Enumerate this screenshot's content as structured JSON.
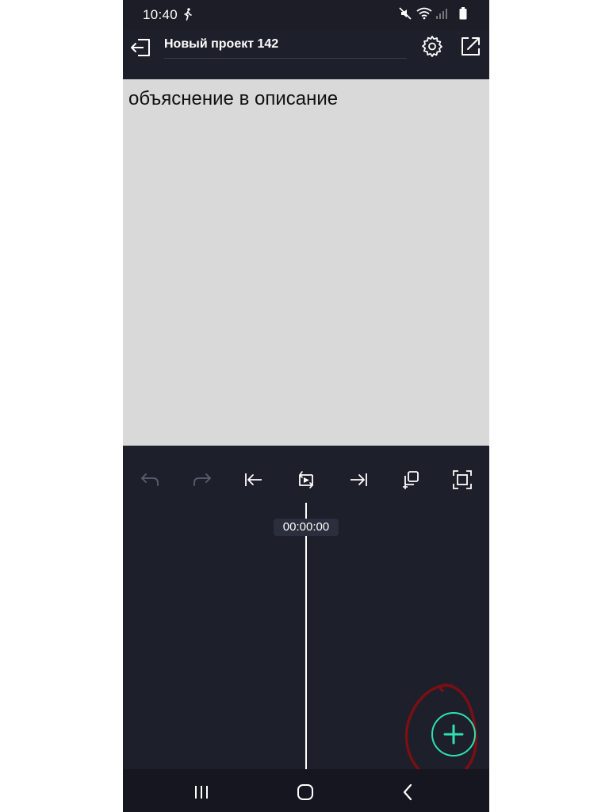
{
  "status_bar": {
    "time": "10:40",
    "icons": [
      "walk-icon",
      "mute-icon",
      "wifi-icon",
      "signal-icon",
      "battery-icon"
    ]
  },
  "header": {
    "project_title": "Новый проект 142",
    "icons": [
      "back-icon",
      "gear-icon",
      "export-icon"
    ]
  },
  "preview": {
    "text": "объяснение в описание",
    "background": "#d9d9d9"
  },
  "toolbar": {
    "tools": [
      "undo-icon",
      "redo-icon",
      "jump-to-start-icon",
      "play-preview-icon",
      "jump-to-end-icon",
      "duplicate-icon",
      "fullscreen-icon"
    ]
  },
  "timeline": {
    "timecode": "00:00:00"
  },
  "fab": {
    "icon": "plus-icon",
    "accent_color": "#2ee2b0"
  },
  "annotation": {
    "color": "#7a0f14"
  },
  "nav_bar": {
    "items": [
      "recent-apps-icon",
      "home-icon",
      "back-nav-icon"
    ]
  }
}
